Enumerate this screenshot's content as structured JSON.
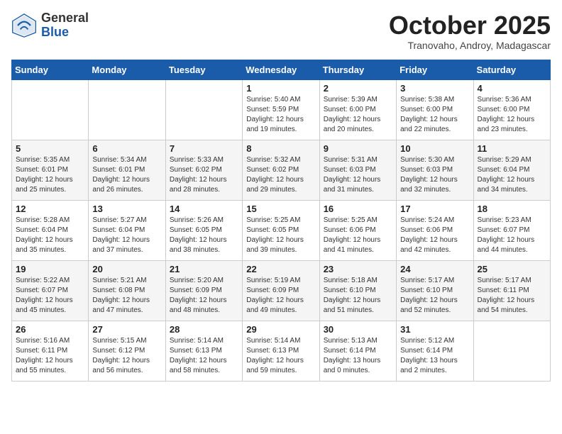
{
  "header": {
    "logo_general": "General",
    "logo_blue": "Blue",
    "month_title": "October 2025",
    "location": "Tranovaho, Androy, Madagascar"
  },
  "days_of_week": [
    "Sunday",
    "Monday",
    "Tuesday",
    "Wednesday",
    "Thursday",
    "Friday",
    "Saturday"
  ],
  "weeks": [
    [
      {
        "day": "",
        "info": ""
      },
      {
        "day": "",
        "info": ""
      },
      {
        "day": "",
        "info": ""
      },
      {
        "day": "1",
        "info": "Sunrise: 5:40 AM\nSunset: 5:59 PM\nDaylight: 12 hours\nand 19 minutes."
      },
      {
        "day": "2",
        "info": "Sunrise: 5:39 AM\nSunset: 6:00 PM\nDaylight: 12 hours\nand 20 minutes."
      },
      {
        "day": "3",
        "info": "Sunrise: 5:38 AM\nSunset: 6:00 PM\nDaylight: 12 hours\nand 22 minutes."
      },
      {
        "day": "4",
        "info": "Sunrise: 5:36 AM\nSunset: 6:00 PM\nDaylight: 12 hours\nand 23 minutes."
      }
    ],
    [
      {
        "day": "5",
        "info": "Sunrise: 5:35 AM\nSunset: 6:01 PM\nDaylight: 12 hours\nand 25 minutes."
      },
      {
        "day": "6",
        "info": "Sunrise: 5:34 AM\nSunset: 6:01 PM\nDaylight: 12 hours\nand 26 minutes."
      },
      {
        "day": "7",
        "info": "Sunrise: 5:33 AM\nSunset: 6:02 PM\nDaylight: 12 hours\nand 28 minutes."
      },
      {
        "day": "8",
        "info": "Sunrise: 5:32 AM\nSunset: 6:02 PM\nDaylight: 12 hours\nand 29 minutes."
      },
      {
        "day": "9",
        "info": "Sunrise: 5:31 AM\nSunset: 6:03 PM\nDaylight: 12 hours\nand 31 minutes."
      },
      {
        "day": "10",
        "info": "Sunrise: 5:30 AM\nSunset: 6:03 PM\nDaylight: 12 hours\nand 32 minutes."
      },
      {
        "day": "11",
        "info": "Sunrise: 5:29 AM\nSunset: 6:04 PM\nDaylight: 12 hours\nand 34 minutes."
      }
    ],
    [
      {
        "day": "12",
        "info": "Sunrise: 5:28 AM\nSunset: 6:04 PM\nDaylight: 12 hours\nand 35 minutes."
      },
      {
        "day": "13",
        "info": "Sunrise: 5:27 AM\nSunset: 6:04 PM\nDaylight: 12 hours\nand 37 minutes."
      },
      {
        "day": "14",
        "info": "Sunrise: 5:26 AM\nSunset: 6:05 PM\nDaylight: 12 hours\nand 38 minutes."
      },
      {
        "day": "15",
        "info": "Sunrise: 5:25 AM\nSunset: 6:05 PM\nDaylight: 12 hours\nand 39 minutes."
      },
      {
        "day": "16",
        "info": "Sunrise: 5:25 AM\nSunset: 6:06 PM\nDaylight: 12 hours\nand 41 minutes."
      },
      {
        "day": "17",
        "info": "Sunrise: 5:24 AM\nSunset: 6:06 PM\nDaylight: 12 hours\nand 42 minutes."
      },
      {
        "day": "18",
        "info": "Sunrise: 5:23 AM\nSunset: 6:07 PM\nDaylight: 12 hours\nand 44 minutes."
      }
    ],
    [
      {
        "day": "19",
        "info": "Sunrise: 5:22 AM\nSunset: 6:07 PM\nDaylight: 12 hours\nand 45 minutes."
      },
      {
        "day": "20",
        "info": "Sunrise: 5:21 AM\nSunset: 6:08 PM\nDaylight: 12 hours\nand 47 minutes."
      },
      {
        "day": "21",
        "info": "Sunrise: 5:20 AM\nSunset: 6:09 PM\nDaylight: 12 hours\nand 48 minutes."
      },
      {
        "day": "22",
        "info": "Sunrise: 5:19 AM\nSunset: 6:09 PM\nDaylight: 12 hours\nand 49 minutes."
      },
      {
        "day": "23",
        "info": "Sunrise: 5:18 AM\nSunset: 6:10 PM\nDaylight: 12 hours\nand 51 minutes."
      },
      {
        "day": "24",
        "info": "Sunrise: 5:17 AM\nSunset: 6:10 PM\nDaylight: 12 hours\nand 52 minutes."
      },
      {
        "day": "25",
        "info": "Sunrise: 5:17 AM\nSunset: 6:11 PM\nDaylight: 12 hours\nand 54 minutes."
      }
    ],
    [
      {
        "day": "26",
        "info": "Sunrise: 5:16 AM\nSunset: 6:11 PM\nDaylight: 12 hours\nand 55 minutes."
      },
      {
        "day": "27",
        "info": "Sunrise: 5:15 AM\nSunset: 6:12 PM\nDaylight: 12 hours\nand 56 minutes."
      },
      {
        "day": "28",
        "info": "Sunrise: 5:14 AM\nSunset: 6:13 PM\nDaylight: 12 hours\nand 58 minutes."
      },
      {
        "day": "29",
        "info": "Sunrise: 5:14 AM\nSunset: 6:13 PM\nDaylight: 12 hours\nand 59 minutes."
      },
      {
        "day": "30",
        "info": "Sunrise: 5:13 AM\nSunset: 6:14 PM\nDaylight: 13 hours\nand 0 minutes."
      },
      {
        "day": "31",
        "info": "Sunrise: 5:12 AM\nSunset: 6:14 PM\nDaylight: 13 hours\nand 2 minutes."
      },
      {
        "day": "",
        "info": ""
      }
    ]
  ]
}
